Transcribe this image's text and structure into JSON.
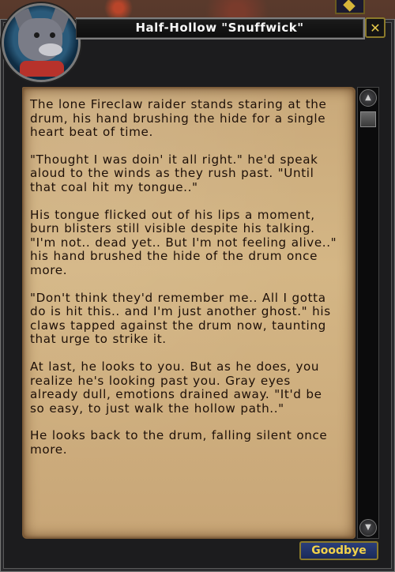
{
  "dialog": {
    "title": "Half-Hollow \"Snuffwick\"",
    "close_symbol": "✕",
    "goodbye_label": "Goodbye",
    "paragraphs": [
      "The lone Fireclaw raider stands staring at the drum, his hand brushing the hide for a single heart beat of time.",
      "\"Thought I was doin' it all right.\" he'd speak aloud to the winds as they rush past. \"Until that coal hit my tongue..\"",
      "His tongue flicked out of his lips a moment, burn blisters still visible despite his talking. \"I'm not.. dead yet.. But I'm not feeling alive..\" his hand brushed the hide of the drum once more.",
      "\"Don't think they'd remember me.. All I gotta do is hit this.. and I'm just another ghost.\" his claws tapped against the drum now, taunting that urge to strike it.",
      "At last, he looks to you. But as he does, you realize he's looking past you. Gray eyes already dull, emotions drained away. \"It'd be so easy, to just walk the hollow path..\"",
      "He looks back to the drum, falling silent once more."
    ]
  },
  "icons": {
    "portrait": "npc-portrait",
    "close": "close-icon",
    "scroll_up": "scroll-up-arrow-icon",
    "scroll_down": "scroll-down-arrow-icon",
    "top_item": "gold-item-icon"
  },
  "colors": {
    "parchment": "#d4b685",
    "text": "#1e1008",
    "title_text": "#f7f7f7",
    "button_text": "#f2d24a",
    "frame": "#1c1c1e"
  }
}
